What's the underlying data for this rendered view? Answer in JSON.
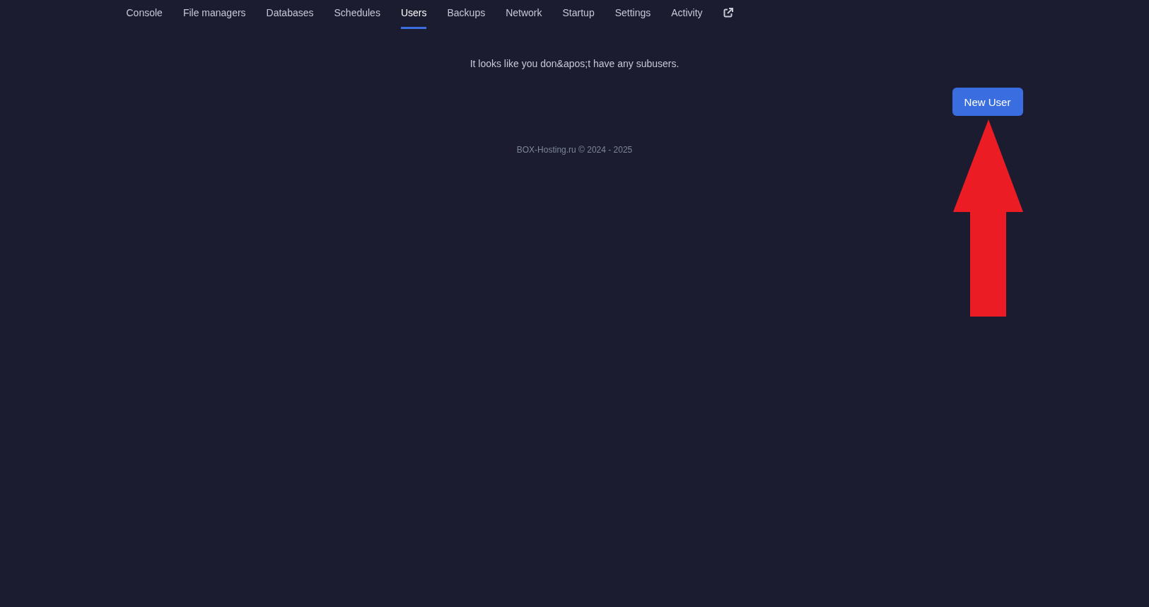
{
  "tabs": [
    {
      "label": "Console",
      "selected": false
    },
    {
      "label": "File managers",
      "selected": false
    },
    {
      "label": "Databases",
      "selected": false
    },
    {
      "label": "Schedules",
      "selected": false
    },
    {
      "label": "Users",
      "selected": true
    },
    {
      "label": "Backups",
      "selected": false
    },
    {
      "label": "Network",
      "selected": false
    },
    {
      "label": "Startup",
      "selected": false
    },
    {
      "label": "Settings",
      "selected": false
    },
    {
      "label": "Activity",
      "selected": false
    }
  ],
  "empty_message": "It looks like you don&apos;t have any subusers.",
  "new_user_button": "New User",
  "footer": "BOX-Hosting.ru © 2024 - 2025"
}
